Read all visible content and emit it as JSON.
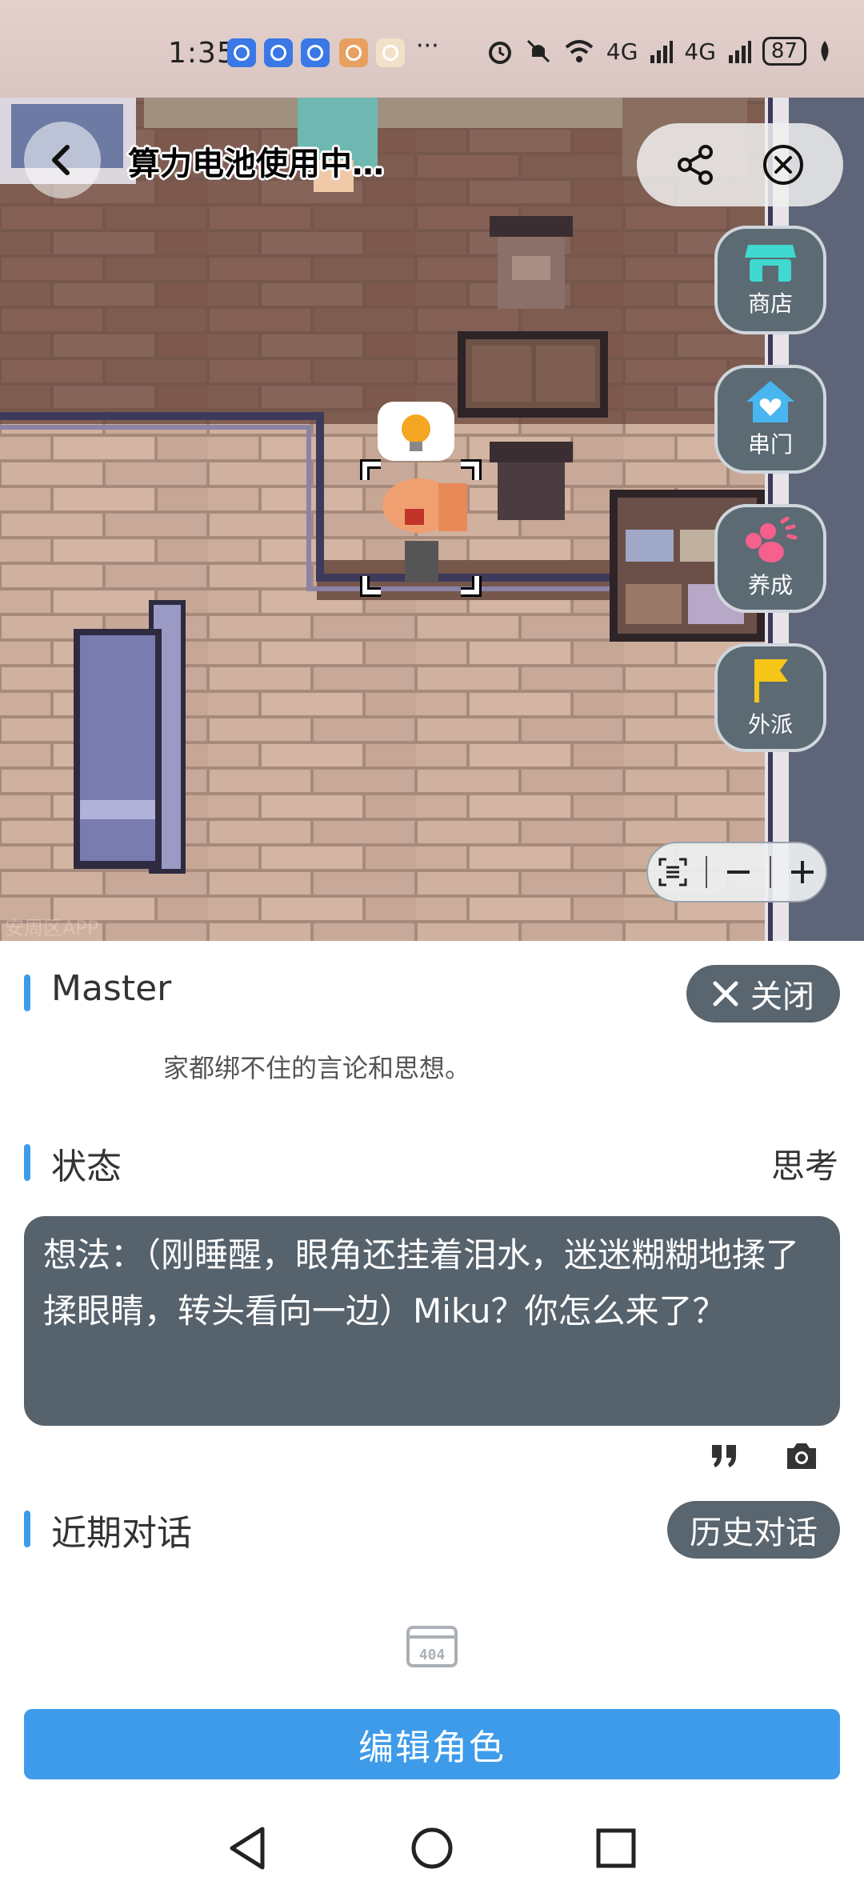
{
  "status_bar": {
    "time": "1:35",
    "more": "···",
    "signal_1": "4G",
    "signal_2": "4G",
    "battery": "87"
  },
  "map": {
    "title": "算力电池使用中…",
    "watermark": "安周区APP",
    "side_buttons": [
      {
        "label": "商店",
        "icon": "shop-icon",
        "color": "#3fd9cf"
      },
      {
        "label": "串门",
        "icon": "home-heart-icon",
        "color": "#49b6f0"
      },
      {
        "label": "养成",
        "icon": "paw-icon",
        "color": "#f5608c"
      },
      {
        "label": "外派",
        "icon": "flag-icon",
        "color": "#f5c518"
      }
    ]
  },
  "character": {
    "name": "Master",
    "close_label": "关闭",
    "description": "家都绑不住的言论和思想。"
  },
  "state": {
    "title": "状态",
    "value": "思考",
    "thought": "想法：（刚睡醒，眼角还挂着泪水，迷迷糊糊地揉了揉眼睛，转头看向一边）Miku？你怎么来了？"
  },
  "recent": {
    "title": "近期对话",
    "history_label": "历史对话",
    "empty_icon_text": "404"
  },
  "edit_button": "编辑角色",
  "colors": {
    "accent": "#3e9bea",
    "panel_dark": "#56626c"
  }
}
